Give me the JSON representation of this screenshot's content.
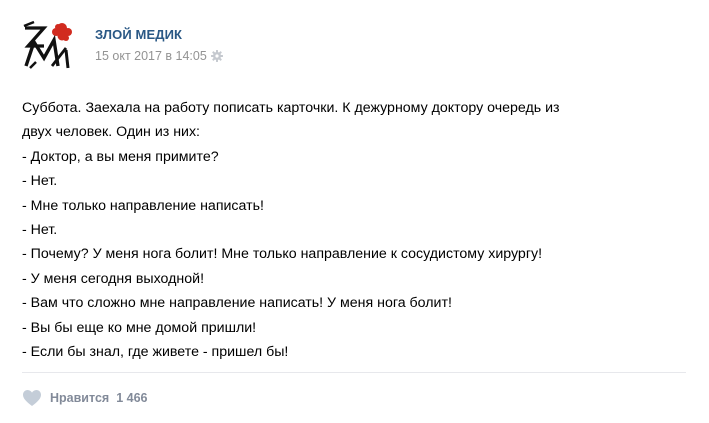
{
  "post": {
    "author": "ЗЛОЙ МЕДИК",
    "date": "15 окт 2017 в 14:05",
    "icons": {
      "avatar": "zm-logo",
      "settings": "gear-icon",
      "like": "heart-icon"
    },
    "lines": [
      "Суббота. Заехала на работу пописать карточки. К дежурному доктору очередь из",
      "двух человек. Один из них:",
      "- Доктор, а вы меня примите?",
      "- Нет.",
      "- Мне только направление написать!",
      "- Нет.",
      "- Почему? У меня нога болит! Мне только направление к сосудистому хирургу!",
      "- У меня сегодня выходной!",
      "- Вам что сложно мне направление написать! У меня нога болит!",
      "- Вы бы еще ко мне домой пришли!",
      "- Если бы знал, где живете - пришел бы!"
    ]
  },
  "footer": {
    "like_label": "Нравится",
    "like_count": "1 466"
  },
  "colors": {
    "author": "#2a5885",
    "meta": "#939393",
    "like": "#828a99",
    "heart": "#c4cdd8",
    "logo_red": "#d12b1f"
  }
}
